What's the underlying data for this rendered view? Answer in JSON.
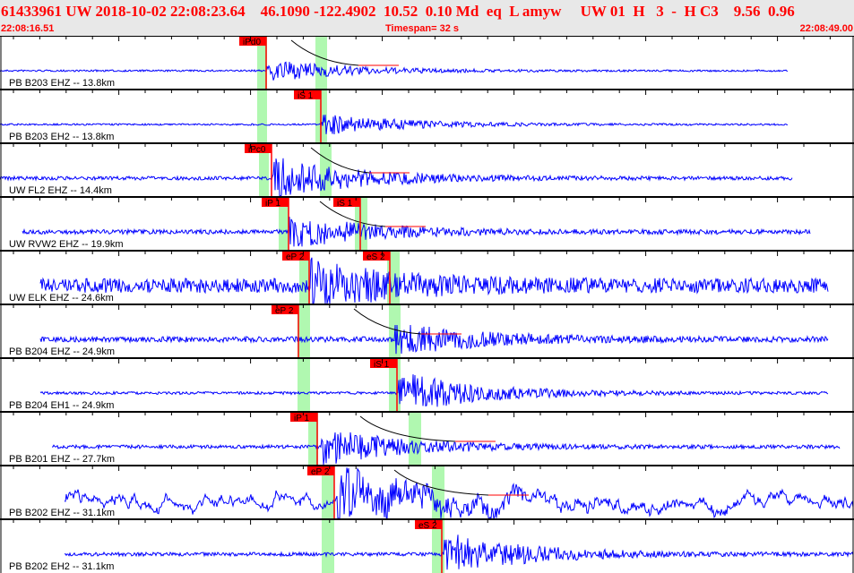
{
  "header": {
    "title": "61433961 UW 2018-10-02 22:08:23.64    46.1090 -122.4902  10.52  0.10 Md  eq  L amyw     UW 01  H   3  -  H C3    9.56  0.96",
    "start_time": "22:08:16.51",
    "timespan": "Timespan=  32 s",
    "end_time": "22:08:49.00"
  },
  "colors": {
    "trace": "#0000ff",
    "pick": "#ff0000",
    "window": "#b0f8b0",
    "header_text": "#ff0000"
  },
  "channels": [
    {
      "label": "PB B203 EHZ -- 13.8km",
      "picks": [
        "iPd0"
      ]
    },
    {
      "label": "PB B203 EH2 -- 13.8km",
      "picks": [
        "iS 1"
      ]
    },
    {
      "label": "UW FL2 EHZ -- 14.4km",
      "picks": [
        "iPc0"
      ]
    },
    {
      "label": "UW RVW2 EHZ -- 19.9km",
      "picks": [
        "iP 1",
        "iS 1"
      ]
    },
    {
      "label": "UW ELK EHZ -- 24.6km",
      "picks": [
        "eP 2",
        "eS 2"
      ]
    },
    {
      "label": "PB B204 EHZ -- 24.9km",
      "picks": [
        "eP 2"
      ]
    },
    {
      "label": "PB B204 EH1 -- 24.9km",
      "picks": [
        "iS 1"
      ]
    },
    {
      "label": "PB B201 EHZ -- 27.7km",
      "picks": [
        "iP 1"
      ]
    },
    {
      "label": "PB B202 EHZ -- 31.1km",
      "picks": [
        "eP 2"
      ]
    },
    {
      "label": "PB B202 EH2 -- 31.1km",
      "picks": [
        "eS 2"
      ]
    }
  ]
}
